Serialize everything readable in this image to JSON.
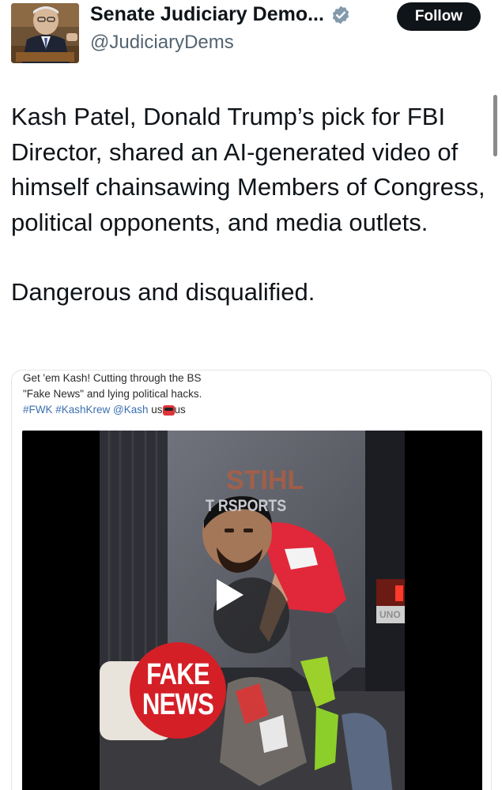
{
  "account": {
    "display_name": "Senate Judiciary Demo...",
    "handle": "@JudiciaryDems",
    "follow_label": "Follow",
    "verified_icon": "verified-badge-icon",
    "verified_color": "#829aab"
  },
  "tweet": {
    "paragraph1": "Kash Patel, Donald Trump’s pick for FBI Director, shared an AI-generated video of himself chainsawing Members of Congress, political opponents, and media outlets.",
    "paragraph2": "Dangerous and disqualified."
  },
  "embedded_post": {
    "caption_line1": "Get 'em Kash! Cutting through the BS",
    "caption_line2": "\"Fake News\" and lying political hacks.",
    "caption_tags": "#FWK #KashKrew @Kash",
    "caption_us1": "us",
    "caption_us2": "us",
    "video": {
      "play_icon": "play-icon",
      "sign_text": "T     RSPORTS",
      "stihl_text": "STIHL",
      "badge_line1": "FAKE",
      "badge_line2": "NEWS",
      "side_text": "UNO"
    }
  },
  "colors": {
    "text": "#0f1419",
    "muted": "#536471",
    "follow_bg": "#0f1419",
    "fake_news_red": "#d41f27",
    "link_blue": "#3b6fb0"
  }
}
